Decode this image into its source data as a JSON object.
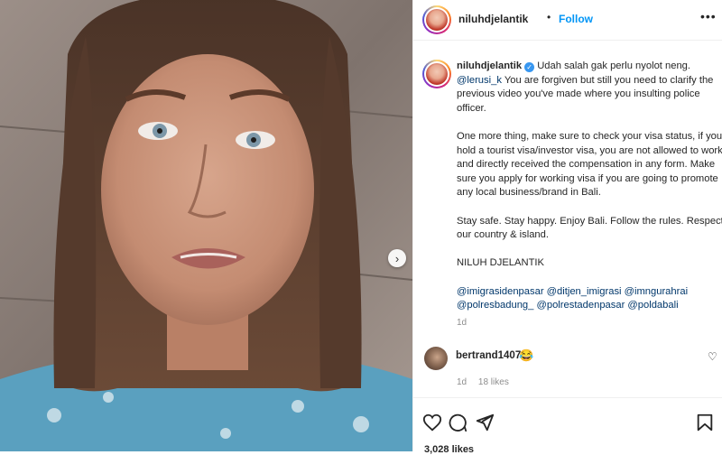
{
  "post": {
    "username": "niluhdjelantik",
    "separator": "•",
    "follow_label": "Follow",
    "more_label": "•••",
    "carousel_next": "›"
  },
  "caption": {
    "username": "niluhdjelantik",
    "p1_text": "Udah salah gak perlu nyolot neng.",
    "p1_mention": "@lerusi_k",
    "p1_rest": "You are forgiven but still you need to clarify the previous video you've made where you insulting police officer.",
    "p2": "One more thing, make sure to check your visa status, if you hold a tourist visa/investor visa, you are not allowed to work and directly received the compensation in any form. Make sure you apply for working visa if you are going to promote any local business/brand in Bali.",
    "p3": "Stay safe. Stay happy. Enjoy Bali. Follow the rules. Respect our country & island.",
    "p4": "NILUH DJELANTIK",
    "tags_line1": "@imigrasidenpasar @ditjen_imigrasi @imngurahrai",
    "tags_line2": "@polresbadung_ @polrestadenpasar @poldabali",
    "time": "1d"
  },
  "comment": {
    "username": "bertrand1407",
    "emoji": "😂",
    "time": "1d",
    "likes": "18 likes"
  },
  "footer": {
    "likes": "3,028 likes"
  },
  "colors": {
    "link": "#0095f6",
    "mention": "#00376b",
    "verified": "#3897f0",
    "muted": "#8e8e8e"
  },
  "icons": [
    "chevron-right-icon",
    "more-icon",
    "verified-icon",
    "heart-icon",
    "comment-icon",
    "share-icon",
    "bookmark-icon"
  ]
}
